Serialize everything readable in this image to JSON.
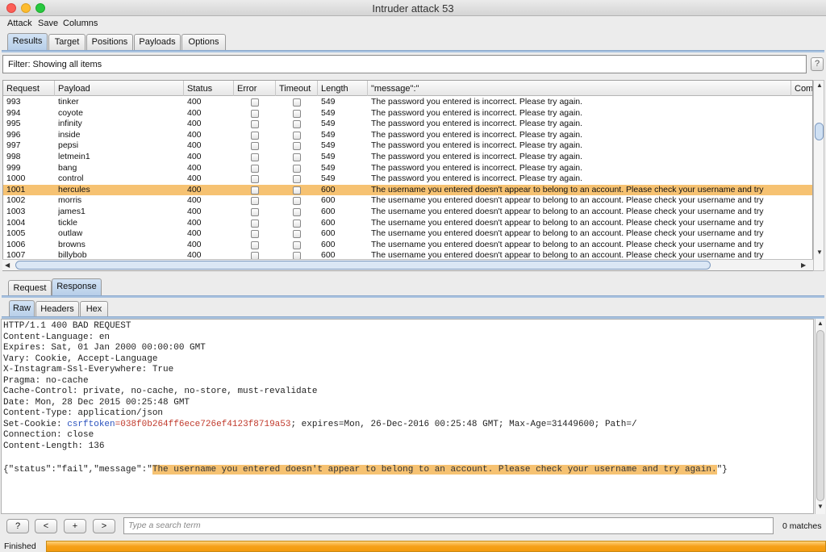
{
  "window": {
    "title": "Intruder attack 53"
  },
  "menu": [
    "Attack",
    "Save",
    "Columns"
  ],
  "main_tabs": [
    "Results",
    "Target",
    "Positions",
    "Payloads",
    "Options"
  ],
  "filter": {
    "text": "Filter: Showing all items",
    "help": "?"
  },
  "table": {
    "columns": [
      "Request",
      "Payload",
      "Status",
      "Error",
      "Timeout",
      "Length",
      "\"message\":\"",
      "Com"
    ],
    "rows": [
      {
        "request": "993",
        "payload": "tinker",
        "status": "400",
        "length": "549",
        "message": "The password you entered is incorrect. Please try again."
      },
      {
        "request": "994",
        "payload": "coyote",
        "status": "400",
        "length": "549",
        "message": "The password you entered is incorrect. Please try again."
      },
      {
        "request": "995",
        "payload": "infinity",
        "status": "400",
        "length": "549",
        "message": "The password you entered is incorrect. Please try again."
      },
      {
        "request": "996",
        "payload": "inside",
        "status": "400",
        "length": "549",
        "message": "The password you entered is incorrect. Please try again."
      },
      {
        "request": "997",
        "payload": "pepsi",
        "status": "400",
        "length": "549",
        "message": "The password you entered is incorrect. Please try again."
      },
      {
        "request": "998",
        "payload": "letmein1",
        "status": "400",
        "length": "549",
        "message": "The password you entered is incorrect. Please try again."
      },
      {
        "request": "999",
        "payload": "bang",
        "status": "400",
        "length": "549",
        "message": "The password you entered is incorrect. Please try again."
      },
      {
        "request": "1000",
        "payload": "control",
        "status": "400",
        "length": "549",
        "message": "The password you entered is incorrect. Please try again."
      },
      {
        "request": "1001",
        "payload": "hercules",
        "status": "400",
        "length": "600",
        "message": "The username you entered doesn't appear to belong to an account. Please check your username and try",
        "selected": true
      },
      {
        "request": "1002",
        "payload": "morris",
        "status": "400",
        "length": "600",
        "message": "The username you entered doesn't appear to belong to an account. Please check your username and try"
      },
      {
        "request": "1003",
        "payload": "james1",
        "status": "400",
        "length": "600",
        "message": "The username you entered doesn't appear to belong to an account. Please check your username and try"
      },
      {
        "request": "1004",
        "payload": "tickle",
        "status": "400",
        "length": "600",
        "message": "The username you entered doesn't appear to belong to an account. Please check your username and try"
      },
      {
        "request": "1005",
        "payload": "outlaw",
        "status": "400",
        "length": "600",
        "message": "The username you entered doesn't appear to belong to an account. Please check your username and try"
      },
      {
        "request": "1006",
        "payload": "browns",
        "status": "400",
        "length": "600",
        "message": "The username you entered doesn't appear to belong to an account. Please check your username and try"
      },
      {
        "request": "1007",
        "payload": "billybob",
        "status": "400",
        "length": "600",
        "message": "The username you entered doesn't appear to belong to an account. Please check your username and try"
      }
    ]
  },
  "reqresp_tabs": [
    "Request",
    "Response"
  ],
  "view_tabs": [
    "Raw",
    "Headers",
    "Hex"
  ],
  "response": {
    "lines": [
      "HTTP/1.1 400 BAD REQUEST",
      "Content-Language: en",
      "Expires: Sat, 01 Jan 2000 00:00:00 GMT",
      "Vary: Cookie, Accept-Language",
      "X-Instagram-Ssl-Everywhere: True",
      "Pragma: no-cache",
      "Cache-Control: private, no-cache, no-store, must-revalidate",
      "Date: Mon, 28 Dec 2015 00:25:48 GMT",
      "Content-Type: application/json"
    ],
    "cookie_prefix": "Set-Cookie: ",
    "cookie_name": "csrftoken",
    "cookie_eq": "=",
    "cookie_value": "038f0b264ff6ece726ef4123f8719a53",
    "cookie_rest": "; expires=Mon, 26-Dec-2016 00:25:48 GMT; Max-Age=31449600; Path=/",
    "lines2": [
      "Connection: close",
      "Content-Length: 136"
    ],
    "body_prefix": "{\"status\":\"fail\",\"message\":\"",
    "body_highlight": "The username you entered doesn't appear to belong to an account. Please check your username and try again.",
    "body_suffix": "\"}"
  },
  "search": {
    "placeholder": "Type a search term",
    "matches": "0 matches",
    "buttons": [
      "?",
      "<",
      "+",
      ">"
    ]
  },
  "status": {
    "label": "Finished",
    "progress": 1.0
  },
  "colors": {
    "selection": "#f6c272",
    "progress": "#f6a019",
    "tab_active": "#b6cde8"
  }
}
